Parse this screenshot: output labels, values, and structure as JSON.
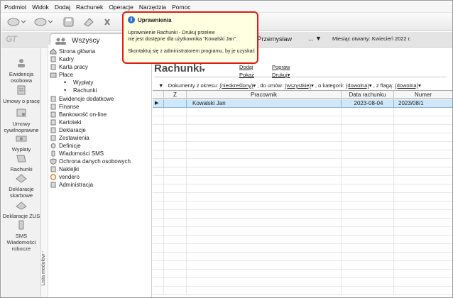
{
  "menu": [
    "Podmiot",
    "Widok",
    "Dodaj",
    "Rachunek",
    "Operacje",
    "Narzędzia",
    "Pomoc"
  ],
  "header": {
    "tab_label": "Wszyscy",
    "company": "i Przemysław",
    "company_dropdown": "...",
    "month_label": "Miesiąc otwarty:",
    "month_value": "Kwiecień 2022 r."
  },
  "left_panel": [
    {
      "label": "Ewidencja\nosobowa",
      "icon": "people-icon"
    },
    {
      "label": "Umowy o pracę",
      "icon": "contract-icon"
    },
    {
      "label": "Umowy\ncywilnoprawne",
      "icon": "civil-contract-icon"
    },
    {
      "label": "Wypłaty",
      "icon": "payments-icon"
    },
    {
      "label": "Rachunki",
      "icon": "bills-icon"
    },
    {
      "label": "Deklaracje\nskarbowe",
      "icon": "tax-declaration-icon"
    },
    {
      "label": "Deklaracje ZUS",
      "icon": "zus-icon"
    },
    {
      "label": "SMS\nWiadomości\nrobocze",
      "icon": "sms-icon"
    }
  ],
  "splitter_label": "Lista modułów",
  "tree": [
    {
      "label": "Strona główna",
      "indent": 0,
      "icon": "home-icon"
    },
    {
      "label": "Kadry",
      "indent": 0,
      "icon": "document-icon"
    },
    {
      "label": "Karta pracy",
      "indent": 0,
      "icon": "document-icon"
    },
    {
      "label": "Płace",
      "indent": 0,
      "icon": "folder-icon"
    },
    {
      "label": "Wypłaty",
      "indent": 1,
      "icon": "bullet-icon"
    },
    {
      "label": "Rachunki",
      "indent": 1,
      "icon": "bullet-icon"
    },
    {
      "label": "Ewidencje dodatkowe",
      "indent": 0,
      "icon": "document-icon"
    },
    {
      "label": "Finanse",
      "indent": 0,
      "icon": "document-icon"
    },
    {
      "label": "Bankowość on-line",
      "indent": 0,
      "icon": "document-icon"
    },
    {
      "label": "Kartoteki",
      "indent": 0,
      "icon": "document-icon"
    },
    {
      "label": "Deklaracje",
      "indent": 0,
      "icon": "document-icon"
    },
    {
      "label": "Zestawienia",
      "indent": 0,
      "icon": "document-icon"
    },
    {
      "label": "Definicje",
      "indent": 0,
      "icon": "gear-icon"
    },
    {
      "label": "Wiadomości SMS",
      "indent": 0,
      "icon": "sms-icon"
    },
    {
      "label": "Ochrona danych osobowych",
      "indent": 0,
      "icon": "shield-icon"
    },
    {
      "label": "Naklejki",
      "indent": 0,
      "icon": "document-icon"
    },
    {
      "label": "vendero",
      "indent": 0,
      "icon": "vendero-icon"
    },
    {
      "label": "Administracja",
      "indent": 0,
      "icon": "document-icon"
    }
  ],
  "main": {
    "title": "Rachunki",
    "actions": {
      "dodaj": "Dodaj",
      "popraw": "Popraw",
      "pokaz": "Pokaż",
      "drukuj": "Drukuj"
    },
    "filters": {
      "prefix": "Dokumenty z okresu:",
      "period": "(nieokreślony)",
      "contracts_label": ", do umów:",
      "contracts": "(wszystkie)",
      "category_label": ", o kategorii:",
      "category": "(dowolna)",
      "flag_label": ", z flagą:",
      "flag": "(dowolna)"
    },
    "columns": [
      "Z",
      "Pracownik",
      "Data rachunku",
      "Numer"
    ],
    "rows": [
      {
        "z": "",
        "pracownik": "Kowalski Jan",
        "data": "2023-08-04",
        "numer": "2023/08/1",
        "selected": true
      }
    ]
  },
  "popup": {
    "title": "Uprawnienia",
    "line1": "Uprawnienie Rachunki - Drukuj przelew",
    "line2": "nie jest dostępne dla użytkownika \"Kowalski Jan\".",
    "line3": "Skontaktuj się z administratorem programu, by je uzyskać",
    "border_color": "#e01a1a"
  },
  "colors": {
    "selection": "#cfe7f8",
    "popup_bg": "#ffffe1"
  }
}
